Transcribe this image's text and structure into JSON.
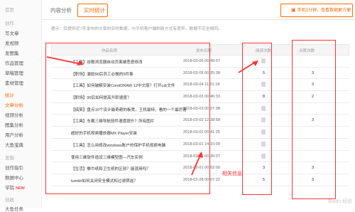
{
  "sidebar": {
    "items": [
      {
        "label": "首页",
        "state": "muted"
      },
      {
        "label": "创作",
        "state": "muted"
      },
      {
        "label": "写文章",
        "state": "normal"
      },
      {
        "label": "发视频",
        "state": "normal"
      },
      {
        "label": "发图集",
        "state": "normal"
      },
      {
        "label": "作品管理",
        "state": "normal"
      },
      {
        "label": "草稿管理",
        "state": "normal"
      },
      {
        "label": "素材管理",
        "state": "normal"
      },
      {
        "label": "统计",
        "state": "active"
      },
      {
        "label": "文章分析",
        "state": "active"
      },
      {
        "label": "视频分析",
        "state": "normal"
      },
      {
        "label": "图集分析",
        "state": "normal"
      },
      {
        "label": "用户分析",
        "state": "normal"
      },
      {
        "label": "大鱼宝典",
        "state": "normal"
      },
      {
        "label": "发现",
        "state": "muted"
      },
      {
        "label": "创作指引",
        "state": "normal"
      },
      {
        "label": "数据中心",
        "state": "normal"
      },
      {
        "label": "学院",
        "state": "normal",
        "badge": "NEW"
      },
      {
        "label": "创收",
        "state": "muted"
      },
      {
        "label": "大鱼任务",
        "state": "normal"
      }
    ]
  },
  "tabs": {
    "content_analysis": "内容分析",
    "realtime_stats": "实时统计",
    "right_link": "手机3分钟，查看数据更方便",
    "right_icon": "arrow-icon"
  },
  "tip": "提示：仅提供近7天发布的文章的实时数据，与手机客户端刷新方式有差异，数据不完全相同。",
  "table": {
    "headers": {
      "title": "作品名称",
      "date": "发布日期",
      "reads": "阅读次数",
      "comments": "点赞次数"
    },
    "rows": [
      {
        "title": "【工具】谷歌浏览器自动页面被恶意修改",
        "date": "2018-03-05 00:49:07",
        "reads": "",
        "comments": ""
      },
      {
        "title": "【职场】激励90后员工必做的5件事",
        "date": "2018-03-05 00:25:38",
        "reads": "5",
        "comments": "3"
      },
      {
        "title": "【工具】如何破解安装CorelDRAW 12中文版？打开cdr文件",
        "date": "2018-03-04 11:01:18",
        "reads": "",
        "comments": "3"
      },
      {
        "title": "【职场】90后如何提高升职速度？",
        "date": "2018-03-03 00:46:33",
        "reads": "8",
        "comments": "2"
      },
      {
        "title": "【搞笑】盘点10个设计最奇葩的板凳，王机最特，看的一个最厉害",
        "date": "2018-03-03 00:37:38",
        "reads": "",
        "comments": ""
      },
      {
        "title": "【工具】车载三维导航软件速度提升？所有图片",
        "date": "2018-03-02 12:28:58",
        "reads": "",
        "comments": "3"
      },
      {
        "title": "超好的手机视频播放器MX Player安装",
        "date": "2018-03-02 00:41:25",
        "reads": "",
        "comments": ""
      },
      {
        "title": "【工具】怎么用修改windows账户的保护手机视频电脑",
        "date": "2018-03-01 14:15:09",
        "reads": "",
        "comments": ""
      },
      {
        "title": "使用三维软件造设三维模型图—汽车实例",
        "date": "2018-03-01 00:35:07",
        "reads": "",
        "comments": ""
      },
      {
        "title": "【生活】餐巾纸和卫生纸的区别？能混用吗？",
        "date": "2018-03-01 00:02:00",
        "reads": "3",
        "comments": "3"
      },
      {
        "title": "tumblr如何关闭安全模式和过滤筛选？",
        "date": "2018-02-28 00:07:22",
        "reads": "5",
        "comments": "3"
      }
    ]
  },
  "annotation": "相关信息",
  "watermark": "Baidu 经验",
  "colors": {
    "accent": "#ff6a00",
    "annotation_red": "#ff3333"
  }
}
